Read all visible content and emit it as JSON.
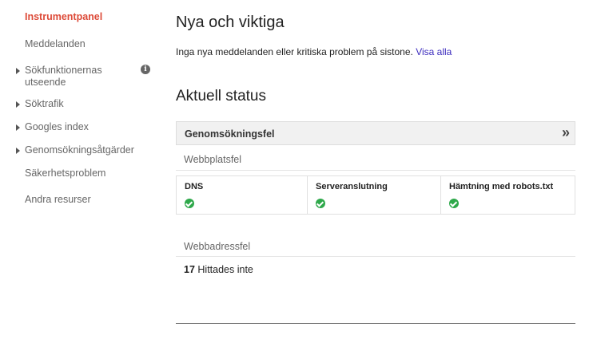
{
  "sidebar": {
    "items": [
      {
        "label": "Instrumentpanel",
        "active": true,
        "expandable": false
      },
      {
        "label": "Meddelanden",
        "active": false,
        "expandable": false
      },
      {
        "label": "Sökfunktionernas utseende",
        "active": false,
        "expandable": true,
        "info": true
      },
      {
        "label": "Söktrafik",
        "active": false,
        "expandable": true
      },
      {
        "label": "Googles index",
        "active": false,
        "expandable": true
      },
      {
        "label": "Genomsökningsåtgärder",
        "active": false,
        "expandable": true
      },
      {
        "label": "Säkerhetsproblem",
        "active": false,
        "expandable": false
      },
      {
        "label": "Andra resurser",
        "active": false,
        "expandable": false
      }
    ]
  },
  "news": {
    "heading": "Nya och viktiga",
    "message": "Inga nya meddelanden eller kritiska problem på sistone.",
    "view_all": "Visa alla"
  },
  "status": {
    "heading": "Aktuell status",
    "panel_title": "Genomsökningsfel",
    "expand_glyph": "»",
    "site_errors": {
      "label": "Webbplatsfel",
      "columns": [
        {
          "title": "DNS",
          "status_icon": "check-circle-icon"
        },
        {
          "title": "Serveranslutning",
          "status_icon": "check-circle-icon"
        },
        {
          "title": "Hämtning med robots.txt",
          "status_icon": "check-circle-icon"
        }
      ]
    },
    "url_errors": {
      "label": "Webbadressfel",
      "count": "17",
      "count_text": "Hittades inte"
    }
  },
  "colors": {
    "active_nav": "#dd4b39",
    "link": "#3b2bbd",
    "ok_green": "#2ea84a"
  }
}
